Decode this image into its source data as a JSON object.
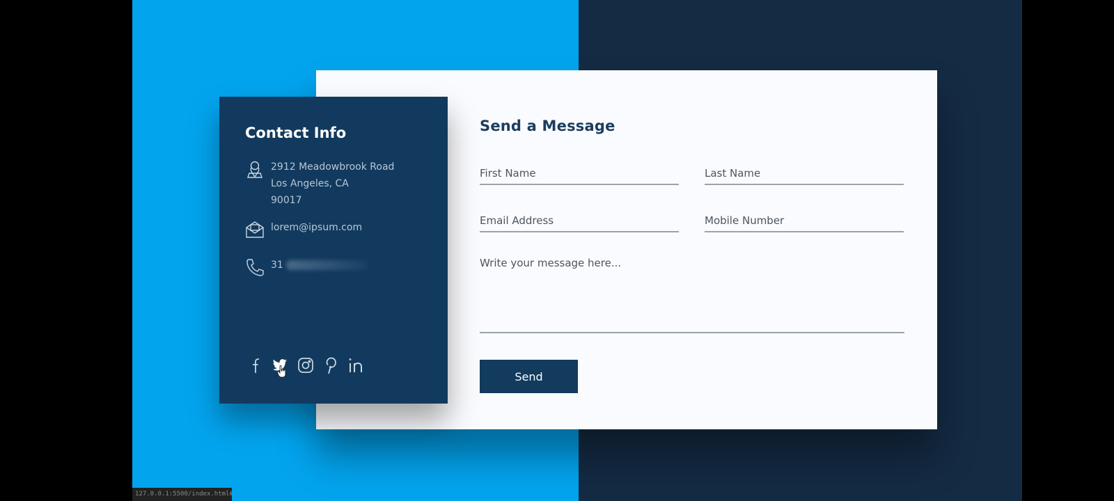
{
  "contact": {
    "title": "Contact Info",
    "address_line1": "2912 Meadowbrook Road",
    "address_line2": "Los Angeles, CA",
    "address_line3": "90017",
    "email": "lorem@ipsum.com",
    "phone_prefix": "31",
    "icons": [
      "location-icon",
      "mail-icon",
      "phone-icon"
    ],
    "socials": [
      "facebook-icon",
      "twitter-icon",
      "instagram-icon",
      "pinterest-icon",
      "linkedin-icon"
    ]
  },
  "form": {
    "title": "Send a Message",
    "first_name_placeholder": "First Name",
    "last_name_placeholder": "Last Name",
    "email_placeholder": "Email Address",
    "mobile_placeholder": "Mobile Number",
    "message_placeholder": "Write your message here...",
    "send_label": "Send"
  },
  "status_bar": {
    "url": "127.0.0.1:5500/index.html#"
  },
  "colors": {
    "left_bg": "#03a4ee",
    "right_bg": "#142b44",
    "card_dark": "#123a5e",
    "button": "#123b5e",
    "form_card": "#fafbfe"
  }
}
